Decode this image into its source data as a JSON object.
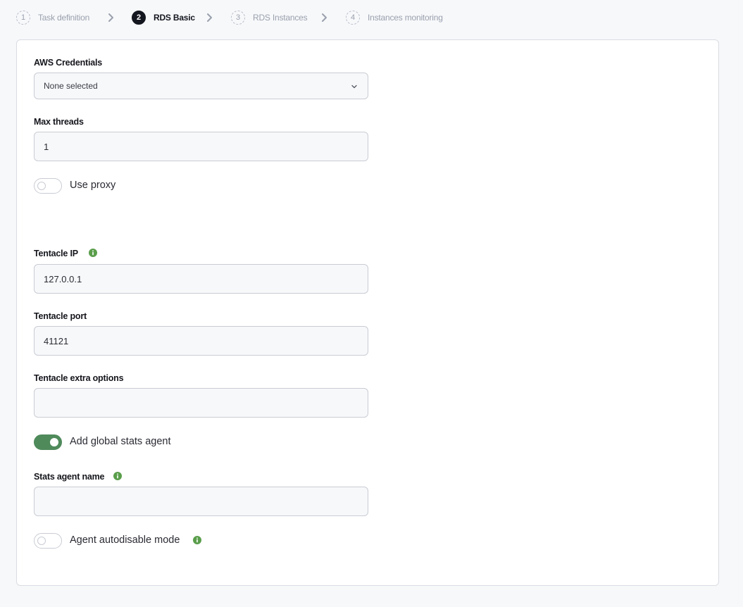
{
  "stepper": {
    "steps": [
      {
        "num": "1",
        "label": "Task definition"
      },
      {
        "num": "2",
        "label": "RDS Basic"
      },
      {
        "num": "3",
        "label": "RDS Instances"
      },
      {
        "num": "4",
        "label": "Instances monitoring"
      }
    ],
    "active_step": 2
  },
  "form": {
    "aws_credentials": {
      "label": "AWS Credentials",
      "value": "None selected"
    },
    "max_threads": {
      "label": "Max threads",
      "value": "1"
    },
    "use_proxy": {
      "label": "Use proxy",
      "enabled": false
    },
    "tentacle_ip": {
      "label": "Tentacle IP",
      "value": "127.0.0.1"
    },
    "tentacle_port": {
      "label": "Tentacle port",
      "value": "41121"
    },
    "tentacle_extra_options": {
      "label": "Tentacle extra options",
      "value": ""
    },
    "add_global_stats_agent": {
      "label": "Add global stats agent",
      "enabled": true
    },
    "stats_agent_name": {
      "label": "Stats agent name",
      "value": ""
    },
    "agent_autodisable_mode": {
      "label": "Agent autodisable mode",
      "enabled": false
    }
  },
  "colors": {
    "accent_green": "#4f8a5b",
    "info_green": "#5a9e4b",
    "active_step": "#14161f",
    "inactive_step": "#9aa0ad"
  },
  "icons": {
    "info": "info-icon",
    "chevron_right": "chevron-right-icon",
    "chevron_down": "chevron-down-icon"
  }
}
